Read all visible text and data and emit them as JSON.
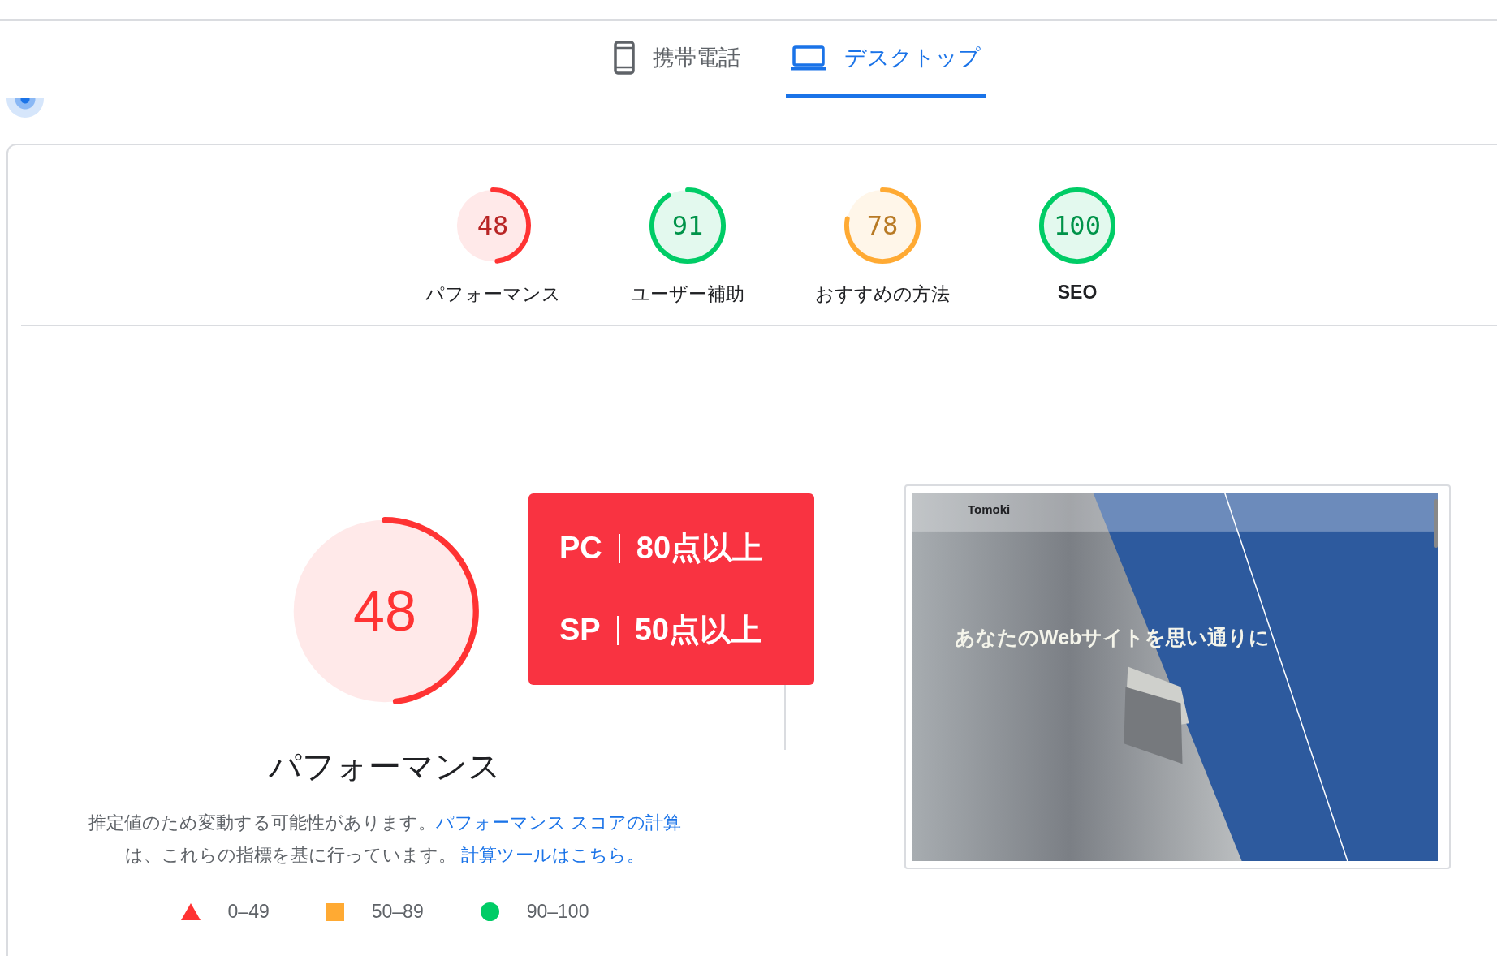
{
  "device_tabs": [
    {
      "label": "携帯電話",
      "kind": "phone",
      "selected": false
    },
    {
      "label": "デスクトップ",
      "kind": "desktop",
      "selected": true
    }
  ],
  "category_scores": [
    {
      "score": "48",
      "label": "パフォーマンス",
      "color": "#ff3333"
    },
    {
      "score": "91",
      "label": "ユーザー補助",
      "color": "#00cc66"
    },
    {
      "score": "78",
      "label": "おすすめの方法",
      "color": "#ffaa33"
    },
    {
      "score": "100",
      "label": "SEO",
      "color": "#00cc66"
    }
  ],
  "performance": {
    "score": "48",
    "level": 0.48,
    "color": "#ff3333",
    "title": "パフォーマンス",
    "description": "推定値のため変動する可能性があります。",
    "link_1": "パフォーマンス スコアの計算",
    "description_2": "は、これらの指標を基に行っています。",
    "link_2": "計算ツールはこちら。"
  },
  "callout": [
    {
      "label": "PC",
      "value": "80点以上"
    },
    {
      "label": "SP",
      "value": "50点以上"
    }
  ],
  "legend": [
    {
      "kind": "triangle",
      "range": "0–49"
    },
    {
      "kind": "square",
      "range": "50–89"
    },
    {
      "kind": "circle",
      "range": "90–100"
    }
  ],
  "site_screenshot": {
    "logo": "Tomoki",
    "headline": "あなたのWebサイトを思い通りに"
  }
}
